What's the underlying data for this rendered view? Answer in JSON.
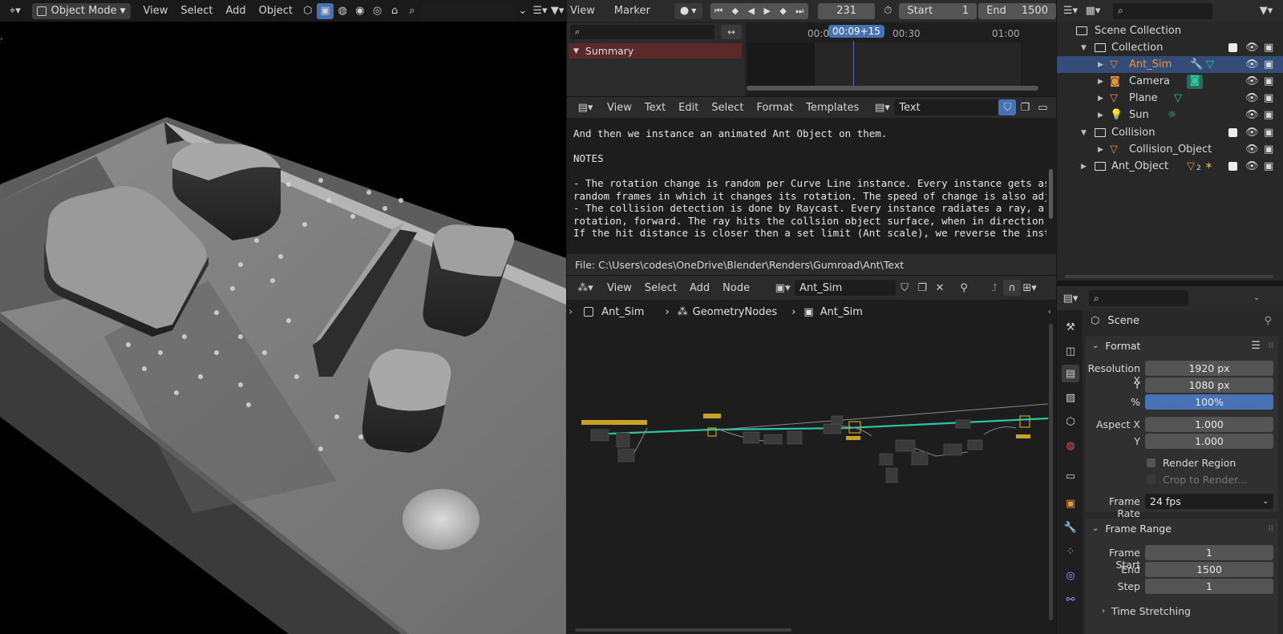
{
  "viewport": {
    "mode_label": "Object Mode",
    "menu": [
      "View",
      "Select",
      "Add",
      "Object"
    ]
  },
  "dopesheet": {
    "menu": [
      "View",
      "Marker"
    ],
    "current_frame": "231",
    "start_label": "Start",
    "start_value": "1",
    "end_label": "End",
    "end_value": "1500",
    "playhead_label": "00:09+15",
    "ruler": [
      "00:0",
      "00:30",
      "01:00"
    ],
    "summary_label": "Summary"
  },
  "text_editor": {
    "menu": [
      "View",
      "Text",
      "Edit",
      "Select",
      "Format",
      "Templates"
    ],
    "datablock_name": "Text",
    "lines": [
      "And then we instance an animated Ant Object on them.",
      "",
      "NOTES",
      "",
      "- The rotation change is random per Curve Line instance. Every instance gets as",
      "random frames in which it changes its rotation. The speed of change is also adj",
      "- The collision detection is done by Raycast. Every instance radiates a ray, a",
      "rotation, forward. The ray hits the collsion object surface, when in direction",
      "If the hit distance is closer then a set limit (Ant scale), we reverse the inst"
    ],
    "file_path": "File: C:\\Users\\codes\\OneDrive\\Blender\\Renders\\Gumroad\\Ant\\Text"
  },
  "node_editor": {
    "menu": [
      "View",
      "Select",
      "Add",
      "Node"
    ],
    "tree_name": "Ant_Sim",
    "breadcrumb": [
      "Ant_Sim",
      "GeometryNodes",
      "Ant_Sim"
    ]
  },
  "outliner": {
    "title": "Scene Collection",
    "rows": [
      {
        "label": "Collection"
      },
      {
        "label": "Ant_Sim"
      },
      {
        "label": "Camera"
      },
      {
        "label": "Plane"
      },
      {
        "label": "Sun"
      },
      {
        "label": "Collision"
      },
      {
        "label": "Collision_Object"
      },
      {
        "label": "Ant_Object"
      }
    ],
    "ant_object_badge": "2"
  },
  "properties": {
    "context": "Scene",
    "format_panel": "Format",
    "resolution_x_label": "Resolution X",
    "resolution_x": "1920 px",
    "y_label": "Y",
    "resolution_y": "1080 px",
    "percent_label": "%",
    "percent": "100%",
    "aspect_x_label": "Aspect X",
    "aspect_x": "1.000",
    "aspect_y": "1.000",
    "render_region": "Render Region",
    "crop_to_render": "Crop to Render...",
    "frame_rate_label": "Frame Rate",
    "frame_rate": "24 fps",
    "frame_range_panel": "Frame Range",
    "frame_start_label": "Frame Start",
    "frame_start": "1",
    "end_label": "End",
    "frame_end": "1500",
    "step_label": "Step",
    "frame_step": "1",
    "time_stretching": "Time Stretching"
  },
  "colors": {
    "accent_blue": "#4772b3",
    "selected_orange": "#e5963b",
    "node_link": "#29c5a5",
    "summary_bg": "#5a2a2a"
  }
}
